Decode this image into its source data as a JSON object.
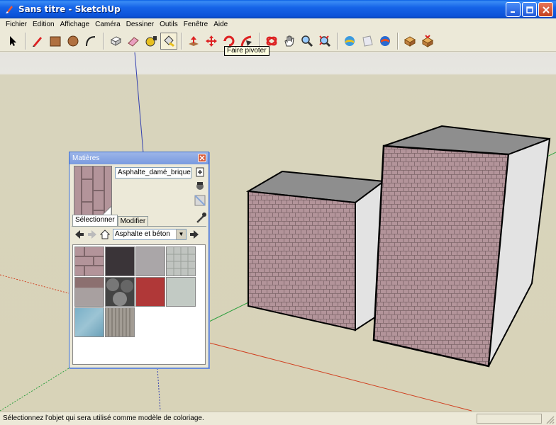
{
  "window": {
    "title": "Sans titre - SketchUp"
  },
  "menu": [
    "Fichier",
    "Edition",
    "Affichage",
    "Caméra",
    "Dessiner",
    "Outils",
    "Fenêtre",
    "Aide"
  ],
  "toolbar": {
    "tools": [
      {
        "name": "select-tool-icon"
      },
      {
        "name": "pencil-tool-icon"
      },
      {
        "name": "rectangle-tool-icon"
      },
      {
        "name": "circle-tool-icon"
      },
      {
        "name": "arc-tool-icon"
      },
      {
        "name": "make-component-icon"
      },
      {
        "name": "eraser-tool-icon"
      },
      {
        "name": "tape-measure-icon"
      },
      {
        "name": "paint-bucket-icon"
      },
      {
        "name": "push-pull-icon"
      },
      {
        "name": "move-tool-icon"
      },
      {
        "name": "rotate-tool-icon"
      },
      {
        "name": "follow-me-icon"
      },
      {
        "name": "orbit-icon"
      },
      {
        "name": "pan-icon"
      },
      {
        "name": "zoom-icon"
      },
      {
        "name": "zoom-extents-icon"
      },
      {
        "name": "get-models-icon"
      },
      {
        "name": "share-model-icon"
      },
      {
        "name": "google-earth-icon"
      },
      {
        "name": "component-share-icon"
      },
      {
        "name": "get-components-icon"
      }
    ],
    "tooltip": "Faire pivoter"
  },
  "materials": {
    "title": "Matières",
    "current_name": "Asphalte_damé_brique",
    "tabs": [
      "Sélectionner",
      "Modifier"
    ],
    "collection": "Asphalte et béton",
    "swatch_colors": [
      "#b3949a",
      "#3a3438",
      "#aaa6a8",
      "#c0c4c0",
      "#a8a0a0",
      "#444444",
      "#b03838",
      "#c2cac4",
      "#7ab0c8",
      "#a29c94"
    ]
  },
  "status": {
    "message": "Sélectionnez l'objet qui sera utilisé comme modèle de coloriage."
  },
  "colors": {
    "accent": "#0a5fe4",
    "brick": "#b3949a",
    "background": "#d8d3b8"
  }
}
